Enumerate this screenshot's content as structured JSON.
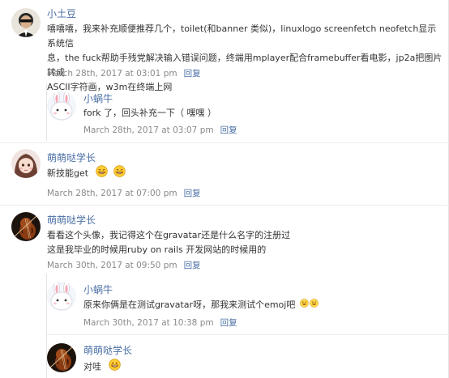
{
  "comments": [
    {
      "author": "小土豆",
      "text_lines": [
        "嘻嘻嘻，我来补充顺便推荐几个，toilet(和banner 类似)，linuxlogo screenfetch neofetch显示系统信",
        "息，the fuck帮助手残党解决输入错误问题，终端用mplayer配合framebuffer看电影，jp2a把图片转成",
        "ASCII字符画，w3m在终端上网"
      ],
      "date": "March 28th, 2017 at 03:01 pm",
      "reply": "回复"
    },
    {
      "author": "小蜗牛",
      "text": "fork 了，回头补充一下（ 嘿嘿 ）",
      "date": "March 28th, 2017 at 03:07 pm",
      "reply": "回复"
    },
    {
      "author": "萌萌哒学长",
      "text": "新技能get",
      "date": "March 28th, 2017 at 07:00 pm",
      "reply": "回复"
    },
    {
      "author": "萌萌哒学长",
      "text_lines": [
        "看看这个头像，我记得这个在gravatar还是什么名字的注册过",
        "这是我毕业的时候用ruby on rails 开发网站的时候用的"
      ],
      "date": "March 30th, 2017 at 09:50 pm",
      "reply": "回复"
    },
    {
      "author": "小蜗牛",
      "text": "原来你俩是在测试gravatar呀，那我来测试个emoj吧",
      "date": "March 30th, 2017 at 10:38 pm",
      "reply": "回复"
    },
    {
      "author": "萌萌哒学长",
      "text": "对哇",
      "date": "",
      "reply": ""
    }
  ],
  "icons": {
    "emoji": "grinning-face-emoji",
    "avatar_colors": {
      "accent": "#4a6fa5",
      "violin": "#8a3b12",
      "bunny": "#f4a6b5"
    }
  }
}
